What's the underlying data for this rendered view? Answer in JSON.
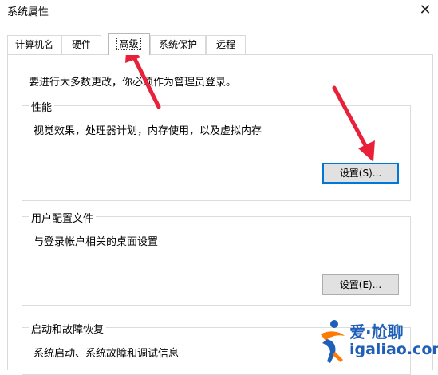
{
  "window": {
    "title": "系统属性",
    "close_glyph": "✕"
  },
  "tabs": [
    {
      "label": "计算机名",
      "active": false
    },
    {
      "label": "硬件",
      "active": false
    },
    {
      "label": "高级",
      "active": true
    },
    {
      "label": "系统保护",
      "active": false
    },
    {
      "label": "远程",
      "active": false
    }
  ],
  "intro": "要进行大多数更改，你必须作为管理员登录。",
  "performance": {
    "title": "性能",
    "desc": "视觉效果，处理器计划，内存使用，以及虚拟内存",
    "button": "设置(S)..."
  },
  "user_profiles": {
    "title": "用户配置文件",
    "desc": "与登录帐户相关的桌面设置",
    "button": "设置(E)..."
  },
  "startup_recovery": {
    "title": "启动和故障恢复",
    "desc": "系统启动、系统故障和调试信息"
  },
  "watermark": {
    "title": "爱·尬聊",
    "subtitle": "igaliao.com"
  },
  "colors": {
    "arrow": "#e8203a",
    "focus": "#0078d7",
    "watermark": "#1f5fb7"
  },
  "icons": [
    "close-icon",
    "red-arrow-icon",
    "watermark-logo-icon"
  ]
}
